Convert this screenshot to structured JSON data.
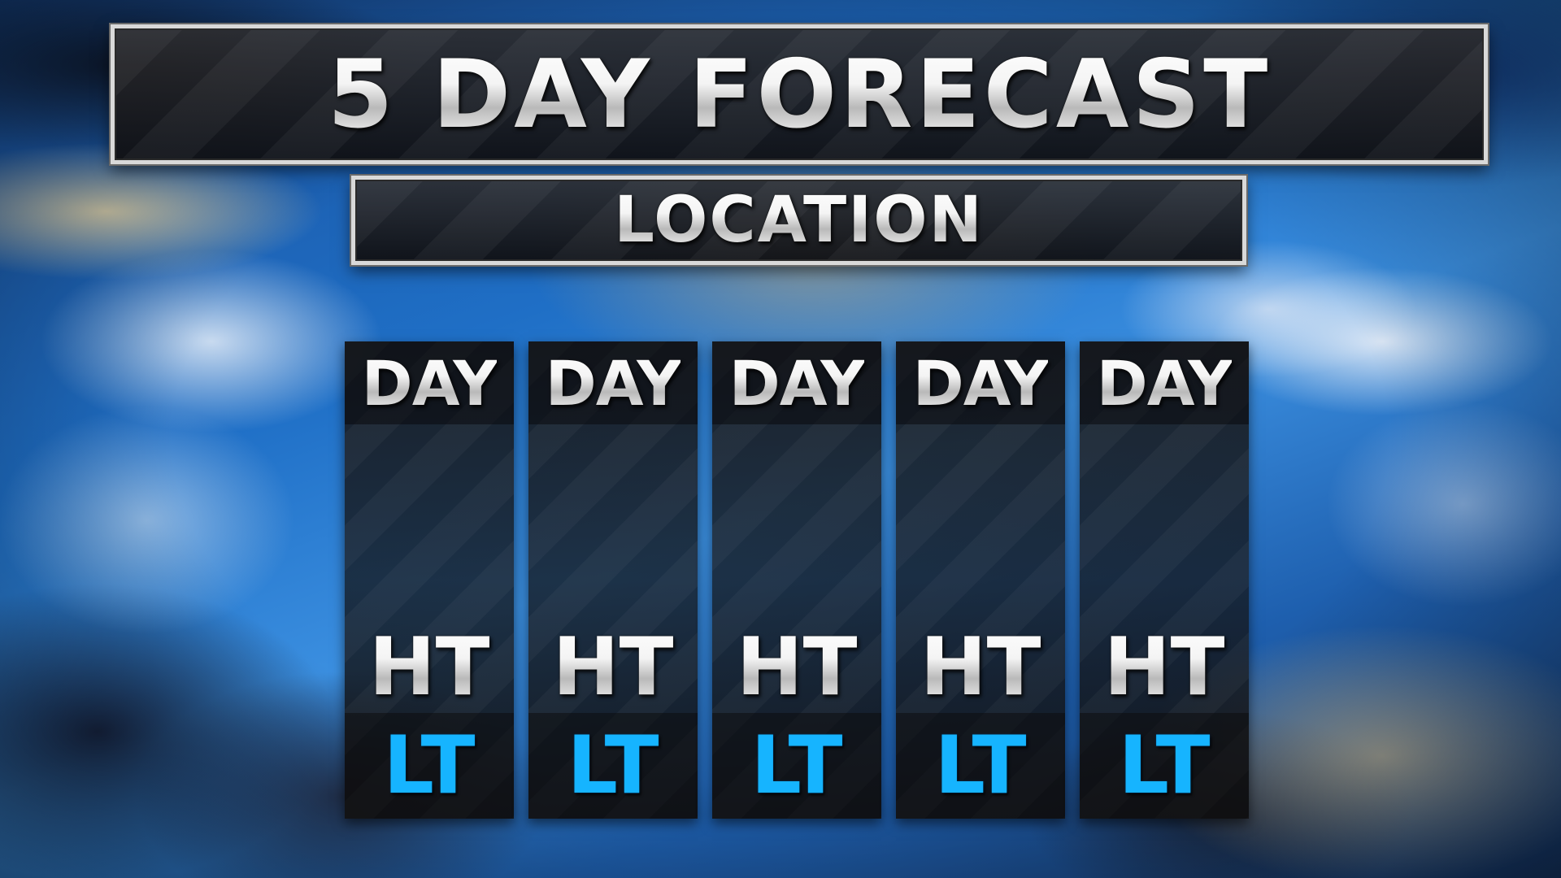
{
  "header": {
    "title": "5 DAY FORECAST",
    "location": "LOCATION"
  },
  "forecast": {
    "days": [
      {
        "day": "DAY",
        "high": "HT",
        "low": "LT"
      },
      {
        "day": "DAY",
        "high": "HT",
        "low": "LT"
      },
      {
        "day": "DAY",
        "high": "HT",
        "low": "LT"
      },
      {
        "day": "DAY",
        "high": "HT",
        "low": "LT"
      },
      {
        "day": "DAY",
        "high": "HT",
        "low": "LT"
      }
    ]
  },
  "colors": {
    "low_temp": "#16b4ff",
    "banner_border": "#d9d9d9",
    "panel": "#1a1a1c"
  }
}
